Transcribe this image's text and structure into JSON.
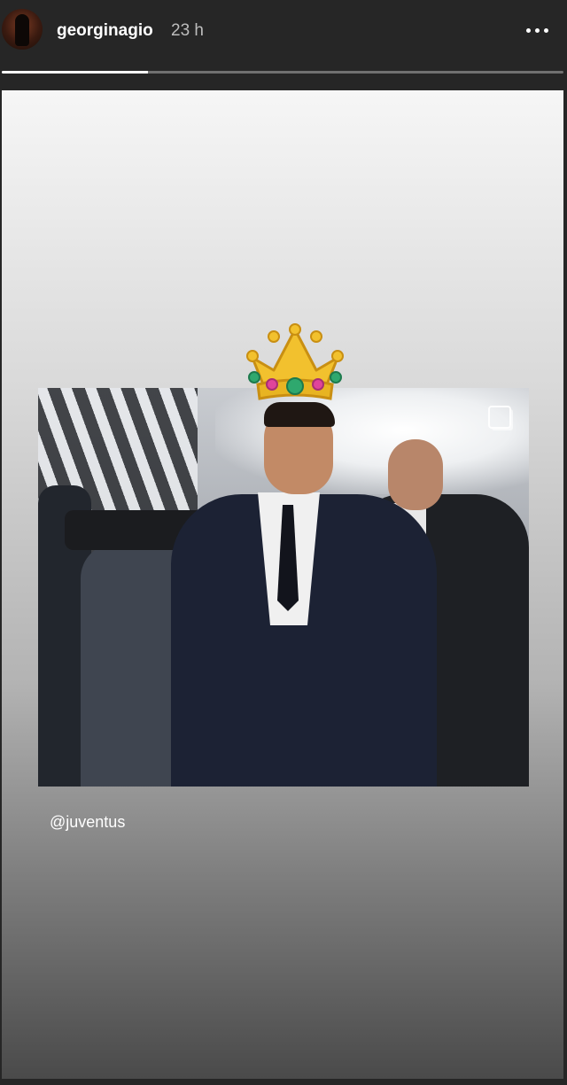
{
  "story": {
    "username": "georginagio",
    "timestamp": "23 h",
    "progress": 0.26,
    "mention": "@juventus"
  },
  "icons": {
    "more": "more-dots-icon",
    "collect": "collect-icon",
    "crown": "crown-icon"
  },
  "colors": {
    "background": "#262626",
    "text": "#ffffff",
    "timestamp": "#bdbdbd",
    "crown_gold": "#f2c12e",
    "gem_green": "#2fa86e",
    "gem_pink": "#e0449a"
  }
}
